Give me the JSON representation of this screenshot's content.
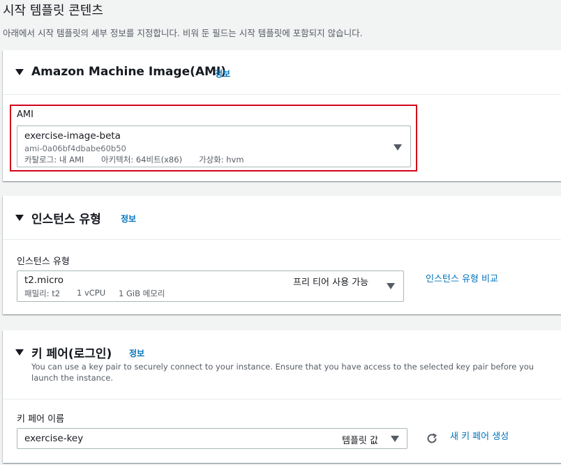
{
  "page": {
    "title": "시작 템플릿 콘텐츠",
    "description": "아래에서 시작 템플릿의 세부 정보를 지정합니다. 비워 둔 필드는 시작 템플릿에 포함되지 않습니다."
  },
  "ami_section": {
    "title": "Amazon Machine Image(AMI)",
    "info": "정보",
    "field_label": "AMI",
    "selected": {
      "name": "exercise-image-beta",
      "id": "ami-0a06bf4dbabe60b50",
      "catalog": "카탈로그: 내 AMI",
      "architecture": "아키텍처: 64비트(x86)",
      "virtualization": "가상화: hvm"
    }
  },
  "instance_section": {
    "title": "인스턴스 유형",
    "info": "정보",
    "field_label": "인스턴스 유형",
    "selected": {
      "name": "t2.micro",
      "family": "패밀리: t2",
      "vcpu": "1 vCPU",
      "memory": "1 GiB 메모리",
      "tag": "프리 티어 사용 가능"
    },
    "compare_link": "인스턴스 유형 비교"
  },
  "keypair_section": {
    "title": "키 페어(로그인)",
    "info": "정보",
    "description": "You can use a key pair to securely connect to your instance. Ensure that you have access to the selected key pair before you launch the instance.",
    "field_label": "키 페어 이름",
    "selected": {
      "name": "exercise-key",
      "tag": "템플릿 값"
    },
    "create_link": "새 키 페어 생성"
  },
  "colors": {
    "link": "#0073bb",
    "highlight": "#d0021b",
    "background": "#f2f3f3"
  }
}
